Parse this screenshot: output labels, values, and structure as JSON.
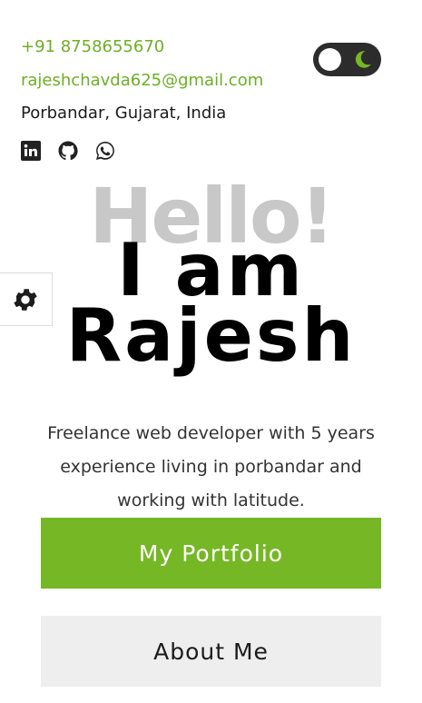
{
  "contact": {
    "phone": "+91 8758655670",
    "email": "rajeshchavda625@gmail.com",
    "location": "Porbandar, Gujarat, India"
  },
  "social": [
    {
      "name": "linkedin-icon"
    },
    {
      "name": "github-icon"
    },
    {
      "name": "whatsapp-icon"
    }
  ],
  "theme_toggle": {
    "state": "light",
    "icon": "moon-icon"
  },
  "settings": {
    "icon": "gear-icon"
  },
  "hero": {
    "greeting": "Hello!",
    "line1": "I am",
    "line2": "Rajesh"
  },
  "bio": "Freelance web developer with 5 years experience living in porbandar and working with latitude.",
  "buttons": {
    "portfolio": "My Portfolio",
    "about": "About Me"
  },
  "colors": {
    "accent": "#76b725",
    "link": "#6bb023",
    "toggle_bg": "#2c2c2c",
    "hello": "#c8c8c8"
  }
}
